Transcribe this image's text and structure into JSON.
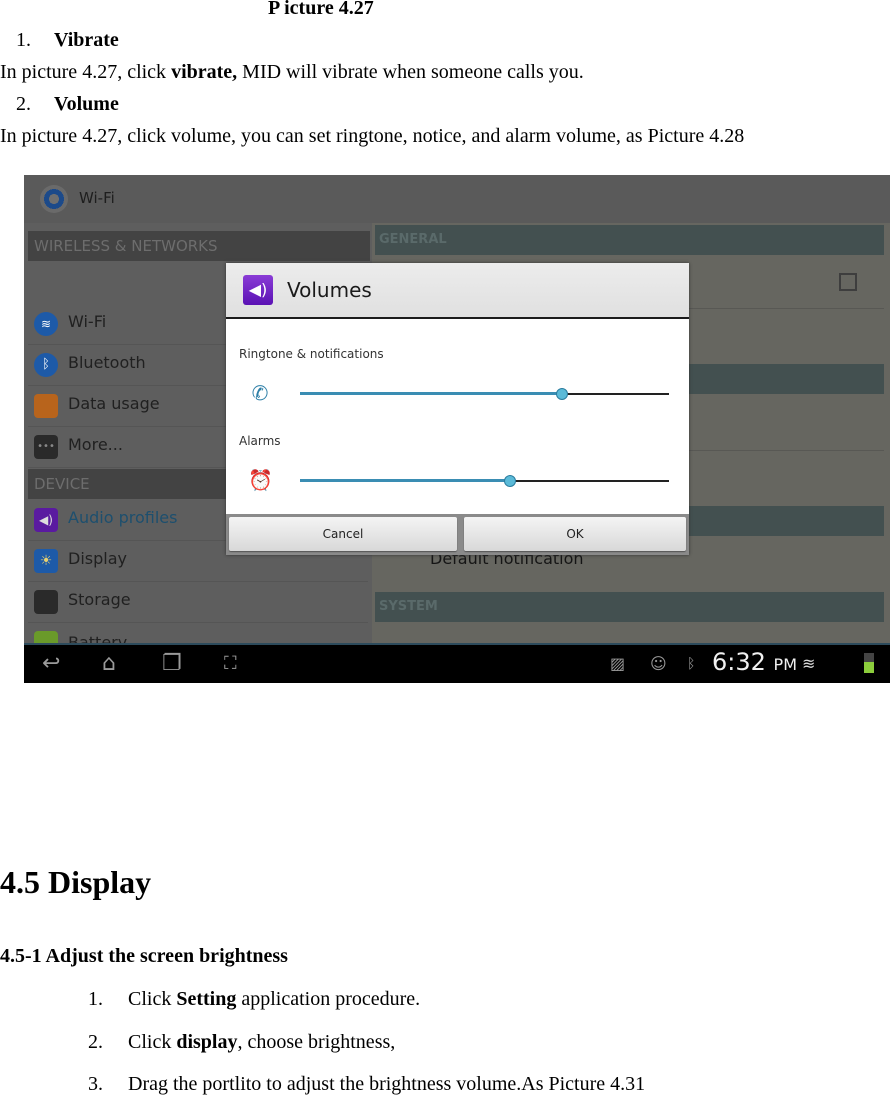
{
  "doc": {
    "caption": "P icture 4.27",
    "item1": {
      "num": "1.",
      "title": "Vibrate"
    },
    "para1": {
      "prefix": "In picture 4.27, click ",
      "bold": "vibrate,",
      "suffix": " MID will vibrate when someone calls you."
    },
    "item2": {
      "num": "2.",
      "title": "Volume"
    },
    "para2": "In picture 4.27, click volume, you can set ringtone, notice, and alarm volume, as Picture 4.28",
    "section_heading": "4.5 Display",
    "subsection_heading": "4.5-1 Adjust the screen brightness",
    "steps": [
      {
        "num": "1.",
        "prefix": "Click ",
        "bold": "Setting",
        "suffix": " application procedure."
      },
      {
        "num": "2.",
        "prefix": "Click ",
        "bold": "display",
        "suffix": ", choose brightness,"
      },
      {
        "num": "3.",
        "prefix": "Drag the portlito to adjust the brightness volume.As Picture 4.31",
        "bold": "",
        "suffix": ""
      }
    ]
  },
  "screenshot": {
    "top_bar": {
      "icon": "settings-gear-icon",
      "title": "Wi-Fi"
    },
    "left_pane": {
      "sections": [
        {
          "header": "WIRELESS & NETWORKS",
          "items": [
            {
              "label": "Wi-Fi",
              "icon": "wifi-icon",
              "color": "#1d5aa8"
            },
            {
              "label": "Bluetooth",
              "icon": "bluetooth-icon",
              "color": "#1d5aa8"
            },
            {
              "label": "Data usage",
              "icon": "data-usage-icon",
              "color": "#c0681c"
            },
            {
              "label": "More...",
              "icon": "more-icon",
              "color": "#2a2a2a"
            }
          ]
        },
        {
          "header": "DEVICE",
          "items": [
            {
              "label": "Audio profiles",
              "icon": "audio-profiles-icon",
              "color": "#5a1aa0",
              "selected": true
            },
            {
              "label": "Display",
              "icon": "display-icon",
              "color": "#1d5aa8"
            },
            {
              "label": "Storage",
              "icon": "storage-icon",
              "color": "#2a2a2a"
            },
            {
              "label": "Battery",
              "icon": "battery-icon",
              "color": "#6a9a2a"
            }
          ]
        }
      ]
    },
    "right_pane": {
      "sections": [
        "GENERAL",
        "",
        "",
        "SYSTEM"
      ],
      "default_notification": "Default notification"
    },
    "dialog": {
      "title": "Volumes",
      "icon": "volume-icon",
      "sliders": [
        {
          "label": "Ringtone & notifications",
          "icon": "ringtone-icon",
          "value_percent": 71
        },
        {
          "label": "Alarms",
          "icon": "alarm-icon",
          "value_percent": 57
        }
      ],
      "cancel_label": "Cancel",
      "ok_label": "OK"
    },
    "nav_bar": {
      "buttons": [
        "back-icon",
        "home-icon",
        "recent-apps-icon",
        "screenshot-icon"
      ],
      "status_icons": [
        "gallery-notification-icon",
        "message-notification-icon",
        "bluetooth-status-icon",
        "wifi-signal-icon",
        "battery-status-icon"
      ],
      "time": "6:32",
      "ampm": "PM"
    },
    "colors": {
      "accent": "#3a8db3",
      "thumb": "#5bbad8",
      "audio_purple": "#6a1fc4"
    }
  }
}
